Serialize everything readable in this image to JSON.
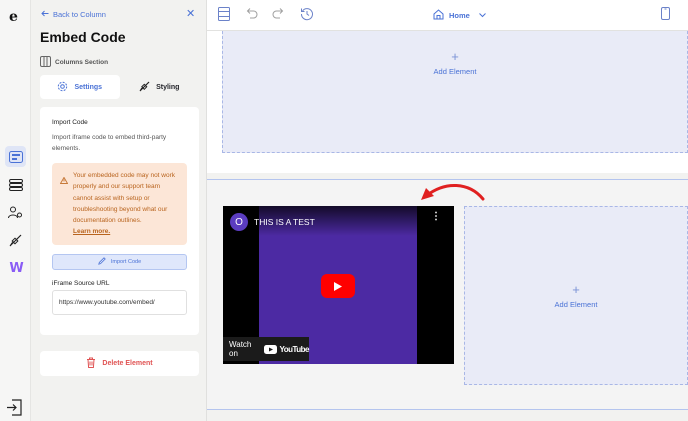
{
  "panel": {
    "back_label": "Back to Column",
    "title": "Embed Code",
    "section_label": "Columns Section",
    "tabs": [
      {
        "label": "Settings",
        "active": true
      },
      {
        "label": "Styling",
        "active": false
      }
    ],
    "import_heading": "Import Code",
    "import_description": "Import iframe code to embed third-party elements.",
    "warning_text": "Your embedded code may not work properly and our support team cannot assist with setup or troubleshooting beyond what our documentation outlines.",
    "warning_link": "Learn more.",
    "import_button": "Import Code",
    "source_label": "iFrame Source URL",
    "source_value": "https://www.youtube.com/embed/",
    "delete_label": "Delete Element"
  },
  "toolbar": {
    "page_selector": "Home"
  },
  "canvas": {
    "add_element_top": "Add Element",
    "add_element_right": "Add Element",
    "video": {
      "avatar_letter": "O",
      "title": "THIS IS A TEST",
      "watch_on": "Watch on",
      "platform": "YouTube"
    }
  },
  "colors": {
    "accent": "#4a72d6",
    "warning_bg": "#fce6d7",
    "warning_text": "#b9641e",
    "delete": "#e05353",
    "dropzone": "#e9ebf7",
    "annotation_arrow": "#e02020"
  }
}
